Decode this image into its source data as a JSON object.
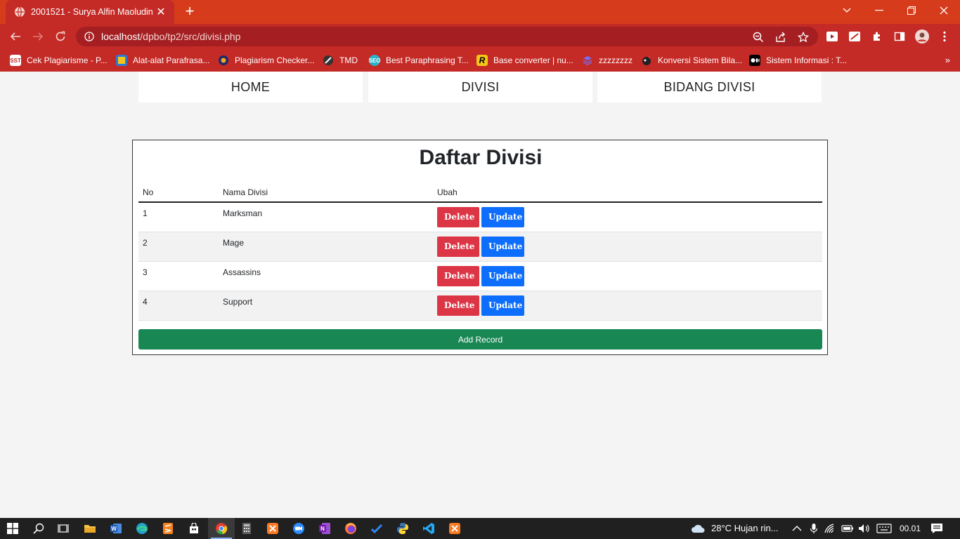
{
  "browser": {
    "tab_title": "2001521 - Surya Alfin Maoludin |",
    "url_host": "localhost",
    "url_path": "/dpbo/tp2/src/divisi.php"
  },
  "bookmarks": [
    {
      "label": "Cek Plagiarisme - P...",
      "icon": "sst-icon",
      "badge": "SST",
      "color": "#ffffff"
    },
    {
      "label": "Alat-alat Parafrasa...",
      "icon": "paraphrase-icon",
      "badge": "",
      "color": "#2b7bd6"
    },
    {
      "label": "Plagiarism Checker...",
      "icon": "plagiarism-icon",
      "badge": "",
      "color": "#1b2a6b"
    },
    {
      "label": "TMD",
      "icon": "tmd-icon",
      "badge": "",
      "color": "#222222"
    },
    {
      "label": "Best Paraphrasing T...",
      "icon": "seo-icon",
      "badge": "SEO",
      "color": "#2bb3c9"
    },
    {
      "label": "Base converter | nu...",
      "icon": "r-icon",
      "badge": "R",
      "color": "#f5c518"
    },
    {
      "label": "zzzzzzzz",
      "icon": "layers-icon",
      "badge": "",
      "color": "#7a6df0"
    },
    {
      "label": "Konversi Sistem Bila...",
      "icon": "konversi-icon",
      "badge": "",
      "color": "#222222"
    },
    {
      "label": "Sistem Informasi : T...",
      "icon": "medium-icon",
      "badge": "",
      "color": "#000000"
    }
  ],
  "nav": {
    "home": "HOME",
    "divisi": "DIVISI",
    "bidang": "BIDANG DIVISI"
  },
  "panel": {
    "title": "Daftar Divisi",
    "headers": {
      "no": "No",
      "name": "Nama Divisi",
      "action": "Ubah"
    },
    "rows": [
      {
        "no": "1",
        "name": "Marksman"
      },
      {
        "no": "2",
        "name": "Mage"
      },
      {
        "no": "3",
        "name": "Assassins"
      },
      {
        "no": "4",
        "name": "Support"
      }
    ],
    "delete_label": "Delete",
    "update_label": "Update",
    "add_label": "Add Record"
  },
  "taskbar": {
    "weather": "28°C  Hujan rin...",
    "time": "00.01"
  },
  "colors": {
    "chrome_red": "#c42a26",
    "tab_strip": "#d63c1c",
    "delete": "#dc3545",
    "update": "#0d6efd",
    "add": "#198754"
  }
}
